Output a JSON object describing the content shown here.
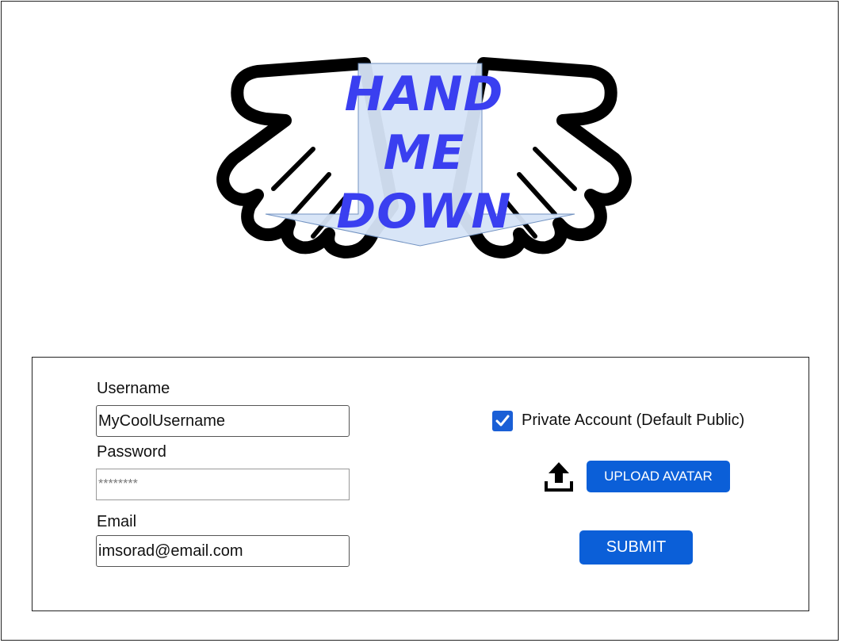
{
  "logo": {
    "lines": [
      "HAND",
      "ME",
      "DOWN"
    ],
    "text_color": "#3a3ff0",
    "banner_color": "#d6e4f7"
  },
  "form": {
    "username": {
      "label": "Username",
      "value": "MyCoolUsername"
    },
    "password": {
      "label": "Password",
      "placeholder": "********"
    },
    "email": {
      "label": "Email",
      "value": "imsorad@email.com"
    },
    "private_account": {
      "label": "Private Account (Default Public)",
      "checked": true
    },
    "upload": {
      "icon": "upload-icon",
      "label": "UPLOAD AVATAR"
    },
    "submit_label": "SUBMIT",
    "accent_color": "#0b5fd8"
  }
}
